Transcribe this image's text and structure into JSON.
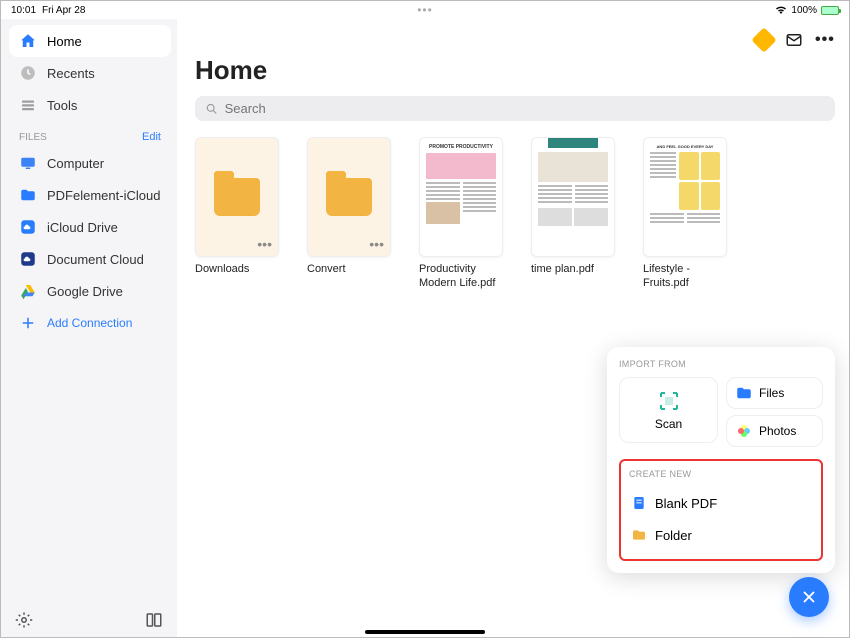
{
  "status": {
    "time": "10:01",
    "date": "Fri Apr 28",
    "battery": "100%"
  },
  "sidebar": {
    "nav": [
      {
        "name": "home",
        "label": "Home",
        "active": true
      },
      {
        "name": "recents",
        "label": "Recents",
        "active": false
      },
      {
        "name": "tools",
        "label": "Tools",
        "active": false
      }
    ],
    "files_header": "FILES",
    "edit_label": "Edit",
    "locations": [
      {
        "name": "computer",
        "label": "Computer"
      },
      {
        "name": "pdfelement-icloud",
        "label": "PDFelement-iCloud"
      },
      {
        "name": "icloud-drive",
        "label": "iCloud Drive"
      },
      {
        "name": "document-cloud",
        "label": "Document Cloud"
      },
      {
        "name": "google-drive",
        "label": "Google Drive"
      }
    ],
    "add_connection": "Add Connection"
  },
  "main": {
    "title": "Home",
    "search_placeholder": "Search"
  },
  "items": [
    {
      "name": "downloads",
      "label": "Downloads",
      "type": "folder"
    },
    {
      "name": "convert",
      "label": "Convert",
      "type": "folder"
    },
    {
      "name": "productivity",
      "label": "Productivity Modern Life.pdf",
      "type": "doc1"
    },
    {
      "name": "time-plan",
      "label": "time plan.pdf",
      "type": "doc2"
    },
    {
      "name": "lifestyle",
      "label": "Lifestyle - Fruits.pdf",
      "type": "doc3"
    }
  ],
  "popup": {
    "import_label": "IMPORT FROM",
    "scan_label": "Scan",
    "files_label": "Files",
    "photos_label": "Photos",
    "create_label": "CREATE NEW",
    "blank_pdf": "Blank PDF",
    "folder": "Folder"
  }
}
